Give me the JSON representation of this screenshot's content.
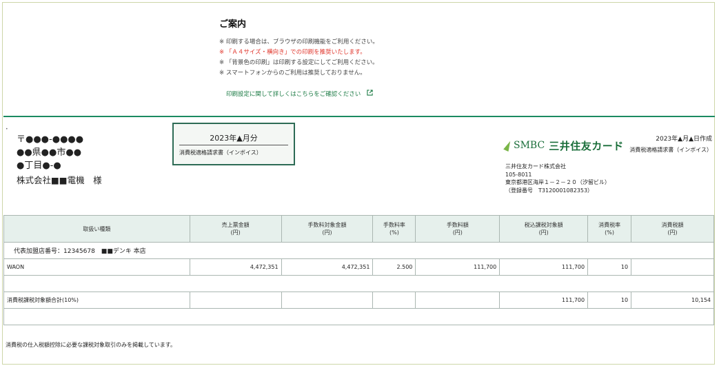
{
  "notice": {
    "title": "ご案内",
    "lines": [
      {
        "text": "※ 印刷する場合は、ブラウザの印刷機能をご利用ください。",
        "color": "normal"
      },
      {
        "text": "※ 「Ａ４サイズ・横向き」での印刷を推奨いたします。",
        "color": "red"
      },
      {
        "text": "※ 「背景色の印刷」は印刷する設定にしてご利用ください。",
        "color": "normal"
      },
      {
        "text": "※ スマートフォンからのご利用は推奨しておりません。",
        "color": "normal"
      }
    ],
    "link_text": "印刷設定に関して詳しくはこちらをご確認ください",
    "link_icon": "external-link-icon"
  },
  "recipient": {
    "postal": "〒●●●-●●●●",
    "line1": "●●県●●市●●",
    "line2": "●丁目●-●",
    "company": "株式会社■■電機　様"
  },
  "period_box": {
    "period": "2023年▲月分",
    "doc_title": "消費税適格請求書（インボイス）"
  },
  "logo": {
    "smbc": "SMBC",
    "name": "三井住友カード",
    "leaf_color": "#7ab648",
    "brand_color": "#1a6e3a"
  },
  "issuer": {
    "company": "三井住友カード株式会社",
    "postal": "105-8011",
    "address": "東京都港区海岸１－２－２０（汐留ビル）",
    "reg_no": "（登録番号　T3120001082353）"
  },
  "created": {
    "date": "2023年▲月▲日作成",
    "doc_title": "消費税適格請求書（インボイス）"
  },
  "table": {
    "headers": [
      {
        "l1": "取扱い種類",
        "l2": ""
      },
      {
        "l1": "売上票金額",
        "l2": "(円)"
      },
      {
        "l1": "手数料対象金額",
        "l2": "(円)"
      },
      {
        "l1": "手数料率",
        "l2": "(%)"
      },
      {
        "l1": "手数料額",
        "l2": "(円)"
      },
      {
        "l1": "税込課税対象額",
        "l2": "(円)"
      },
      {
        "l1": "消費税率",
        "l2": "(%)"
      },
      {
        "l1": "消費税額",
        "l2": "(円)"
      }
    ],
    "agency": "代表加盟店番号：12345678　■■デンキ 本店",
    "rows": [
      {
        "type": "WAON",
        "sales": "4,472,351",
        "fee_base": "4,472,351",
        "fee_rate": "2.500",
        "fee": "111,700",
        "taxable": "111,700",
        "tax_rate": "10",
        "tax": ""
      }
    ],
    "total": {
      "type": "消費税課税対象額合計(10%)",
      "sales": "",
      "fee_base": "",
      "fee_rate": "",
      "fee": "",
      "taxable": "111,700",
      "tax_rate": "10",
      "tax": "10,154"
    }
  },
  "footer_note": "消費税の仕入税額控除に必要な課税対象取引のみを掲載しています。"
}
